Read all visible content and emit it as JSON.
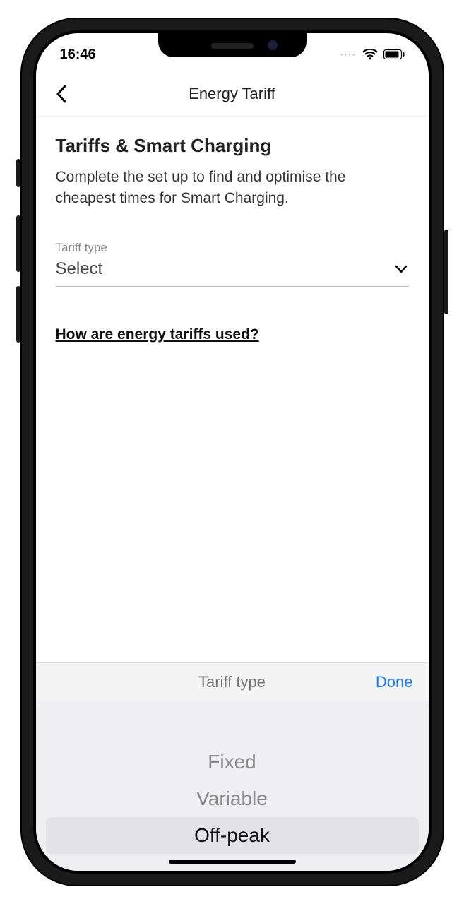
{
  "status": {
    "time": "16:46",
    "signal_dots": "····"
  },
  "nav": {
    "title": "Energy Tariff"
  },
  "page": {
    "heading": "Tariffs & Smart Charging",
    "description": "Complete the set up to find and optimise the cheapest times for Smart Charging."
  },
  "field": {
    "label": "Tariff type",
    "value": "Select"
  },
  "help": {
    "link_label": "How are energy tariffs used?"
  },
  "picker": {
    "title": "Tariff type",
    "done_label": "Done",
    "options": {
      "0": "Fixed",
      "1": "Variable",
      "2": "Off-peak"
    },
    "selected_index": 2
  },
  "colors": {
    "ios_blue": "#1a7cff"
  }
}
